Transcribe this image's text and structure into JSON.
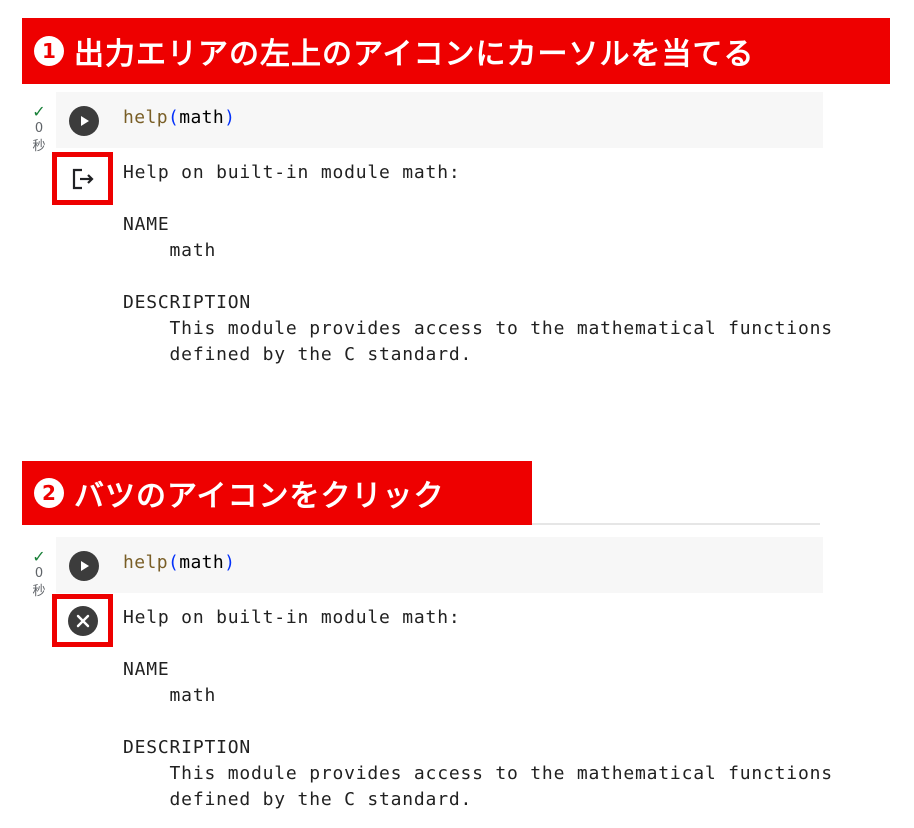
{
  "step1": {
    "number": "1",
    "text": "出力エリアの左上のアイコンにカーソルを当てる"
  },
  "step2": {
    "number": "2",
    "text": "バツのアイコンをクリック"
  },
  "cell": {
    "status_check": "✓",
    "exec_seconds": "0",
    "exec_unit": "秒",
    "code_fn": "help",
    "code_open": "(",
    "code_arg": "math",
    "code_close": ")",
    "output_text": "Help on built-in module math:\n\nNAME\n    math\n\nDESCRIPTION\n    This module provides access to the mathematical functions\n    defined by the C standard."
  },
  "icons": {
    "run": "play-icon",
    "output_action": "output-popout-icon",
    "clear_output": "close-circle-icon"
  },
  "colors": {
    "banner": "#ee0000",
    "success": "#188038",
    "code_function": "#795e26",
    "code_paren": "#0431fa"
  }
}
